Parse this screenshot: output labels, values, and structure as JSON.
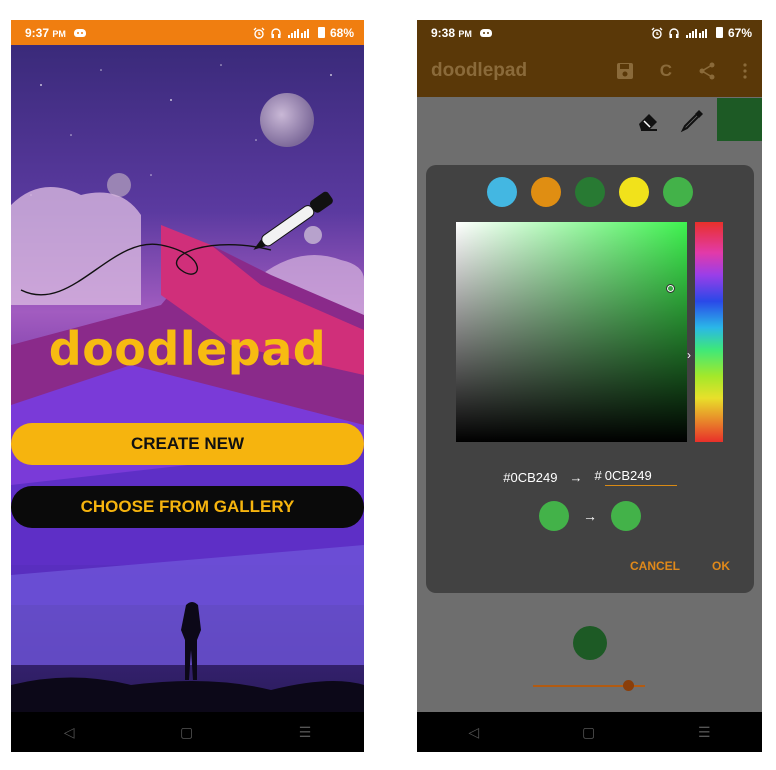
{
  "screen1": {
    "status": {
      "time": "9:37",
      "ampm": "PM",
      "battery": "68%"
    },
    "title": "doodlepad",
    "create_label": "CREATE NEW",
    "gallery_label": "CHOOSE FROM GALLERY",
    "nav": {
      "back": "◁",
      "home": "▢",
      "menu": "☰"
    }
  },
  "screen2": {
    "status": {
      "time": "9:38",
      "ampm": "PM",
      "battery": "67%"
    },
    "appbar": {
      "title": "doodlepad",
      "clear_label": "C"
    },
    "preset_colors": [
      "#43b7e2",
      "#e08e12",
      "#287a33",
      "#f1e21b",
      "#43b249"
    ],
    "picker": {
      "old_hex": "#0CB249",
      "arrow": "→",
      "hash": "#",
      "new_hex": "0CB249",
      "old_color": "#43b249",
      "new_color": "#43b249",
      "hue_arrow": "›"
    },
    "cancel_label": "CANCEL",
    "ok_label": "OK",
    "current_color": "#1d5a25",
    "brush_size_fraction": 0.85,
    "nav": {
      "back": "◁",
      "home": "▢",
      "menu": "☰"
    }
  },
  "colors": {
    "accent": "#f6b40e",
    "status_orange": "#f07e10",
    "appbar_brown": "#5a3808",
    "dialog_bg": "#424242",
    "action_orange": "#e0891a"
  },
  "icons": [
    "alarm-icon",
    "headphones-icon",
    "signal-icon",
    "battery-icon",
    "save-icon",
    "share-icon",
    "more-vert-icon",
    "eraser-icon",
    "eyedropper-icon"
  ]
}
